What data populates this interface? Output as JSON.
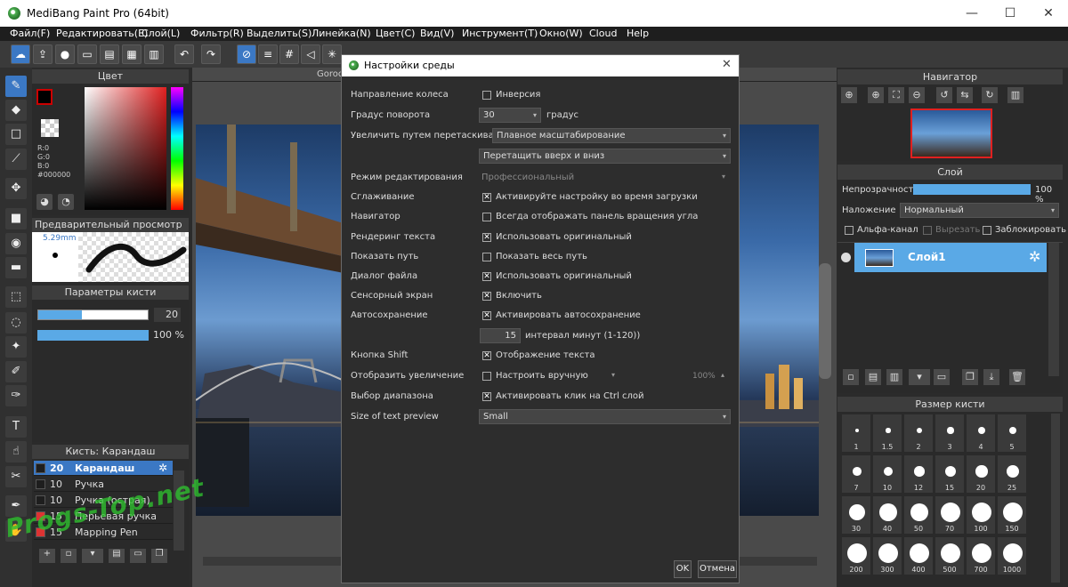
{
  "app": {
    "title": "MediBang Paint Pro (64bit)"
  },
  "menu": [
    "Файл(F)",
    "Редактировать(E)",
    "Слой(L)",
    "Фильтр(R)",
    "Выделить(S)",
    "Линейка(N)",
    "Цвет(C)",
    "Вид(V)",
    "Инструмент(T)",
    "Окно(W)",
    "Cloud",
    "Help"
  ],
  "canvas": {
    "tab_title": "Gorod"
  },
  "color_panel": {
    "title": "Цвет",
    "rgb": [
      "R:0",
      "G:0",
      "B:0"
    ],
    "hex": "#000000"
  },
  "preview_panel": {
    "title": "Предварительный просмотр к...",
    "size": "5.29mm"
  },
  "brush_params": {
    "title": "Параметры кисти",
    "size": "20",
    "opacity": "100 %"
  },
  "brush_list": {
    "title": "Кисть: Карандаш",
    "items": [
      {
        "size": "20",
        "name": "Карандаш",
        "color": "#1e1e1e"
      },
      {
        "size": "10",
        "name": "Ручка",
        "color": "#1e1e1e"
      },
      {
        "size": "10",
        "name": "Ручка (острая)",
        "color": "#1e1e1e"
      },
      {
        "size": "15",
        "name": "Перьевая ручка",
        "color": "#d33"
      },
      {
        "size": "15",
        "name": "Mapping Pen",
        "color": "#d33"
      }
    ]
  },
  "navigator": {
    "title": "Навигатор"
  },
  "layer_panel": {
    "title": "Слой",
    "opacity_label": "Непрозрачность",
    "opacity_value": "100 %",
    "blend_label": "Наложение",
    "blend_value": "Нормальный",
    "alpha_label": "Альфа-канал",
    "clip_label": "Вырезать",
    "lock_label": "Заблокировать",
    "layer_name": "Слой1"
  },
  "brush_size_panel": {
    "title": "Размер кисти",
    "sizes": [
      "1",
      "1.5",
      "2",
      "3",
      "4",
      "5",
      "7",
      "10",
      "12",
      "15",
      "20",
      "25",
      "30",
      "40",
      "50",
      "70",
      "100",
      "150",
      "200",
      "300",
      "400",
      "500",
      "700",
      "1000"
    ]
  },
  "dialog": {
    "title": "Настройки среды",
    "rows": {
      "wheel_dir": {
        "label": "Направление колеса",
        "check": "Инверсия",
        "checked": false
      },
      "rotate": {
        "label": "Градус поворота",
        "value": "30",
        "unit": "градус"
      },
      "zoom_drag": {
        "label": "Увеличить путем перетаскивания",
        "value": "Плавное масштабирование",
        "value2": "Перетащить вверх и вниз"
      },
      "edit_mode": {
        "label": "Режим редактирования",
        "value": "Профессиональный"
      },
      "smoothing": {
        "label": "Сглаживание",
        "check": "Активируйте настройку во время загрузки",
        "checked": true
      },
      "navigator": {
        "label": "Навигатор",
        "check": "Всегда отображать панель вращения угла",
        "checked": false
      },
      "text_render": {
        "label": "Рендеринг текста",
        "check": "Использовать оригинальный",
        "checked": true
      },
      "show_path": {
        "label": "Показать путь",
        "check": "Показать весь путь",
        "checked": false
      },
      "file_dialog": {
        "label": "Диалог файла",
        "check": "Использовать оригинальный",
        "checked": true
      },
      "touch": {
        "label": "Сенсорный экран",
        "check": "Включить",
        "checked": true
      },
      "autosave": {
        "label": "Автосохранение",
        "check": "Активировать автосохранение",
        "checked": true,
        "interval": "15",
        "interval_label": "интервал минут (1-120))"
      },
      "shift": {
        "label": "Кнопка Shift",
        "check": "Отображение текста",
        "checked": true
      },
      "zoom_show": {
        "label": "Отобразить увеличение",
        "check": "Настроить вручную",
        "checked": false,
        "percent": "100%"
      },
      "range": {
        "label": "Выбор диапазона",
        "check": "Активировать клик на Ctrl слой",
        "checked": true
      },
      "text_preview": {
        "label": "Size of text preview",
        "value": "Small"
      }
    },
    "ok": "OK",
    "cancel": "Отмена"
  },
  "watermark": "Progs-Top.net"
}
